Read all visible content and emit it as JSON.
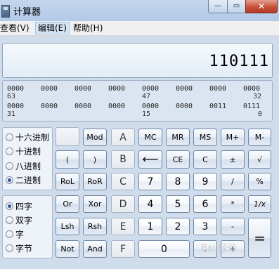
{
  "window": {
    "title": "计算器",
    "minimize": "—",
    "maximize": "▭",
    "close": "✕"
  },
  "menu": {
    "items": [
      "查看(V)",
      "编辑(E)",
      "帮助(H)"
    ]
  },
  "display": {
    "value": "110111"
  },
  "binary_panel": {
    "row1": [
      "0000",
      "0000",
      "0000",
      "0000",
      "0000",
      "0000",
      "0000",
      "0000"
    ],
    "row1_bits": [
      "63",
      "47",
      "32"
    ],
    "row2": [
      "0000",
      "0000",
      "0000",
      "0000",
      "0000",
      "0000",
      "0011",
      "0111"
    ],
    "row2_bits": [
      "31",
      "15",
      "0"
    ]
  },
  "base_options": {
    "items": [
      "十六进制",
      "十进制",
      "八进制",
      "二进制"
    ],
    "selected": "二进制"
  },
  "word_options": {
    "items": [
      "四字",
      "双字",
      "字",
      "字节"
    ],
    "selected": "四字"
  },
  "buttons": {
    "mod": "Mod",
    "A": "A",
    "mc": "MC",
    "mr": "MR",
    "ms": "MS",
    "mplus": "M+",
    "mminus": "M-",
    "lparen": "(",
    "rparen": ")",
    "B": "B",
    "backspace": "⟵",
    "ce": "CE",
    "c": "C",
    "plusminus": "±",
    "sqrt": "√",
    "rol": "RoL",
    "ror": "RoR",
    "C": "C",
    "n7": "7",
    "n8": "8",
    "n9": "9",
    "div": "/",
    "pct": "%",
    "or": "Or",
    "xor": "Xor",
    "D": "D",
    "n4": "4",
    "n5": "5",
    "n6": "6",
    "mul": "*",
    "recip": "1/x",
    "lsh": "Lsh",
    "rsh": "Rsh",
    "E": "E",
    "n1": "1",
    "n2": "2",
    "n3": "3",
    "sub": "-",
    "eq": "=",
    "not": "Not",
    "and": "And",
    "F": "F",
    "n0": "0",
    "dot": ".",
    "add": "+"
  },
  "watermark": "Bai 经验"
}
